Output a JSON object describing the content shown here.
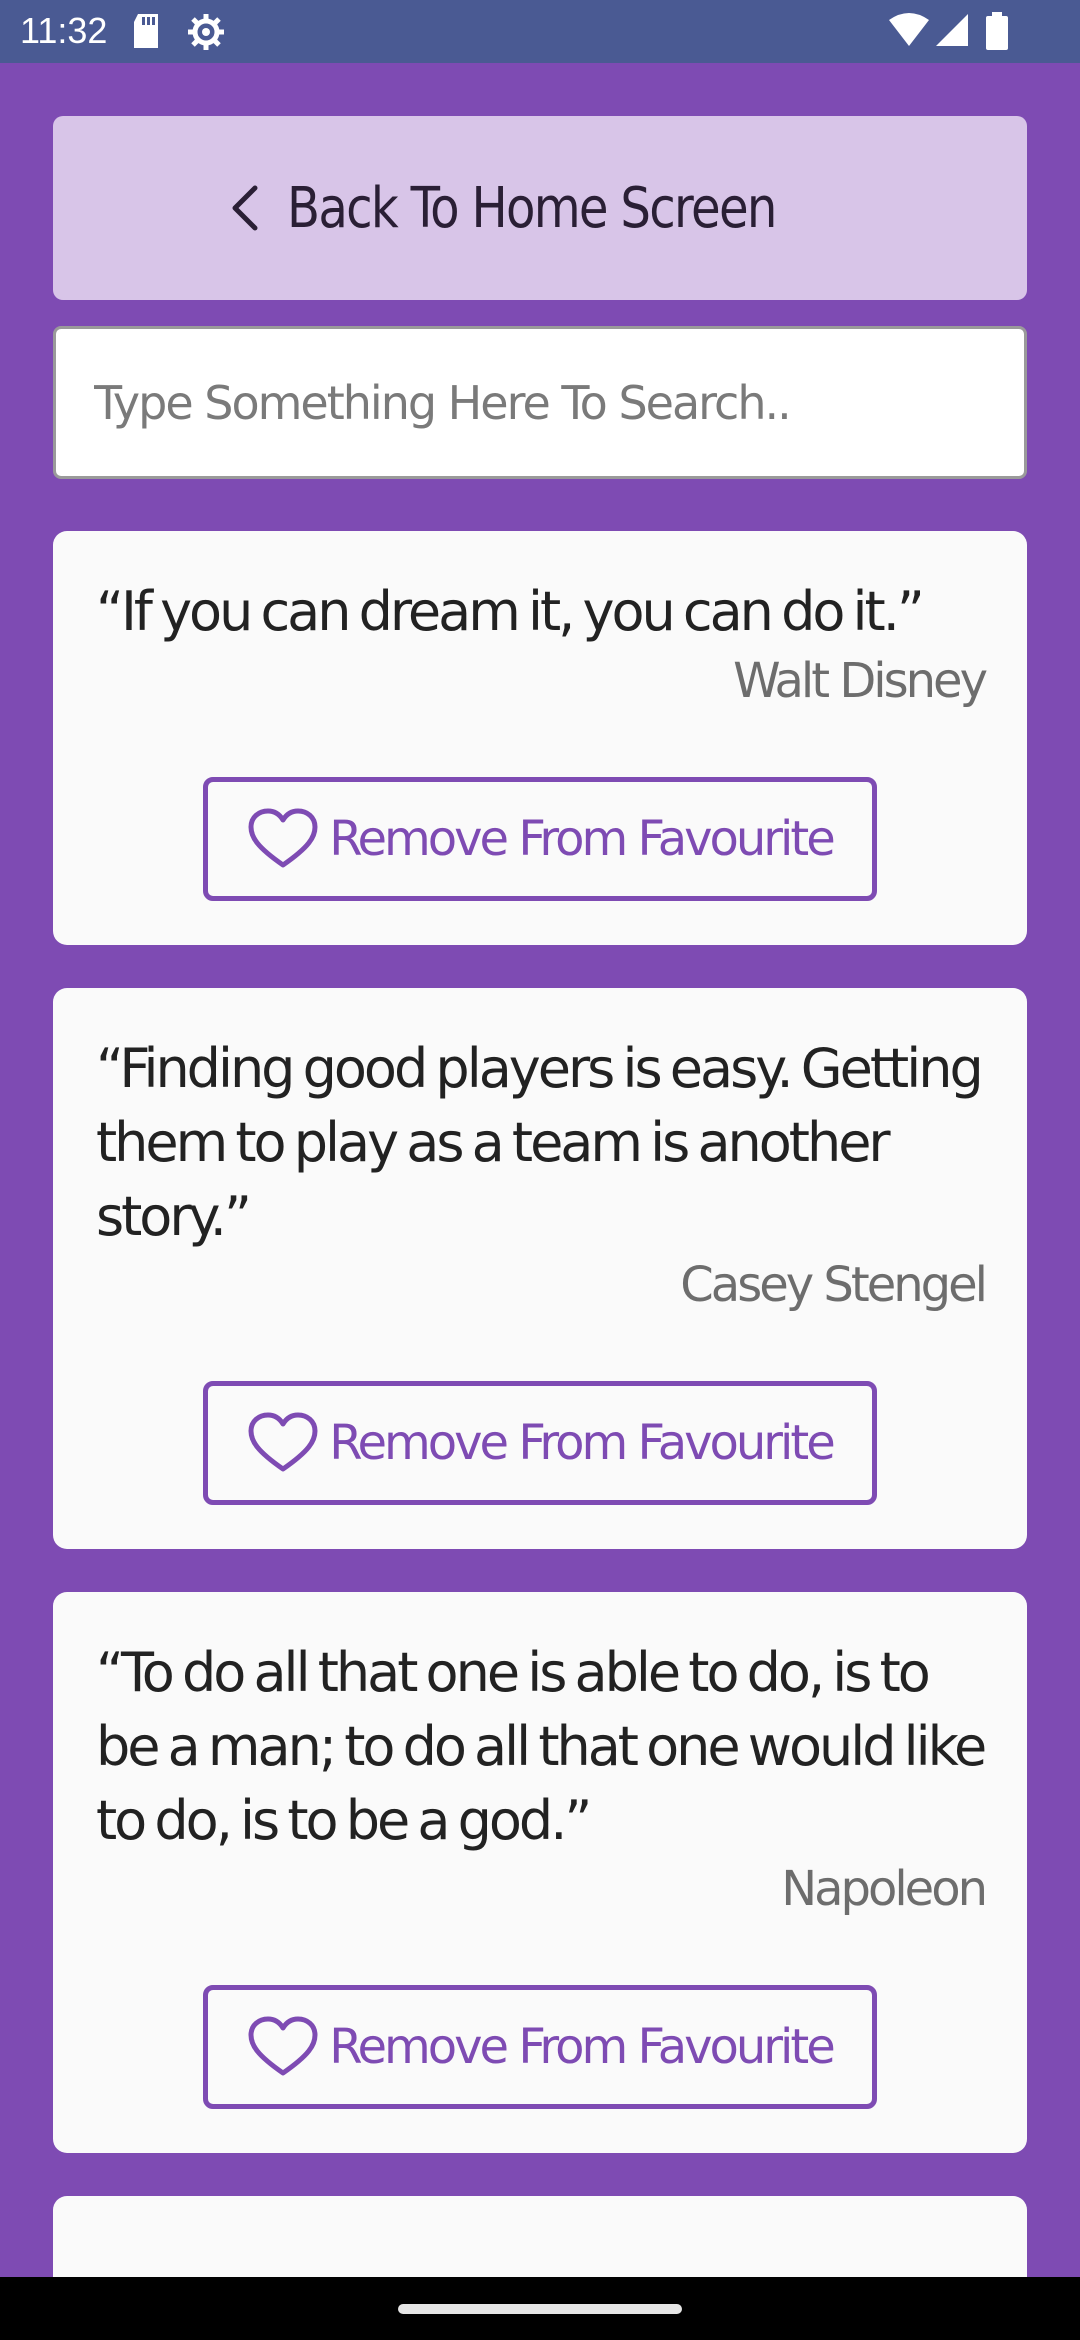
{
  "status_bar": {
    "time": "11:32",
    "icons": [
      "sd-card-icon",
      "settings-icon",
      "wifi-icon",
      "signal-icon",
      "battery-icon"
    ]
  },
  "header": {
    "back_label": "Back To Home Screen",
    "back_icon": "chevron-left-icon"
  },
  "search": {
    "placeholder": "Type Something Here To Search..",
    "value": ""
  },
  "quotes": [
    {
      "text": "“If you can dream it, you can do it.”",
      "author": "Walt Disney",
      "button_label": "Remove From Favourite"
    },
    {
      "text": "“Finding good players is easy. Getting them to play as a team is another story.”",
      "author": "Casey Stengel",
      "button_label": "Remove From Favourite"
    },
    {
      "text": "“To do all that one is able to do, is to be a man; to do all that one would like to do, is to be a god.”",
      "author": "Napoleon",
      "button_label": "Remove From Favourite"
    }
  ],
  "colors": {
    "background": "#7e4bb3",
    "status_bar": "#4a5a93",
    "back_button": "#d8c5e8",
    "card": "#fafafa",
    "accent": "#7e4bb3",
    "author_text": "#6d6d6d"
  }
}
